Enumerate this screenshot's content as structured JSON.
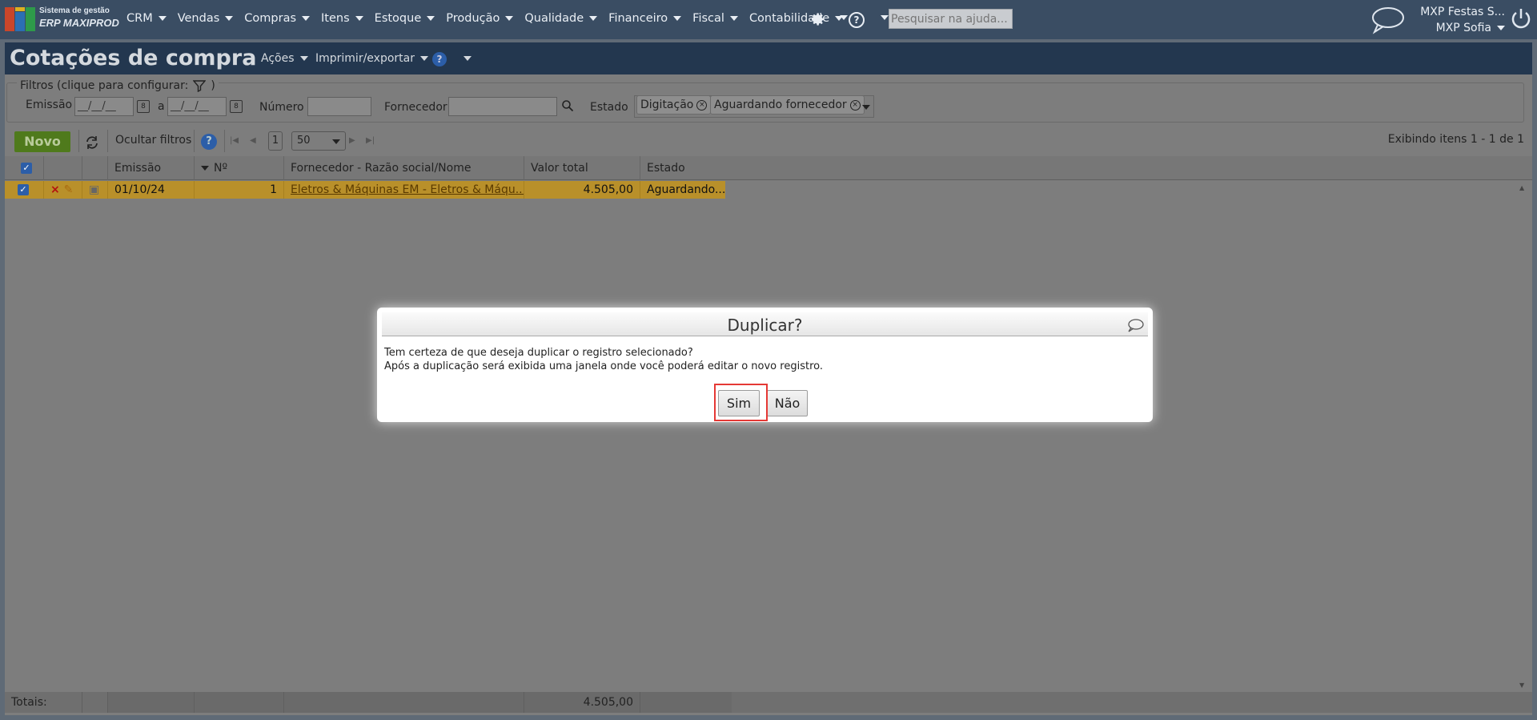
{
  "app": {
    "logo_line1": "Sistema de gestão",
    "logo_line2": "ERP MAXIPROD",
    "menu": [
      "CRM",
      "Vendas",
      "Compras",
      "Itens",
      "Estoque",
      "Produção",
      "Qualidade",
      "Financeiro",
      "Fiscal",
      "Contabilidade"
    ],
    "help_search_placeholder": "Pesquisar na ajuda...",
    "company": "MXP Festas S...",
    "user": "MXP Sofia",
    "icons": [
      "logo-icon",
      "gear-icon",
      "help-icon",
      "chat-icon",
      "power-icon"
    ]
  },
  "page": {
    "title": "Cotações de compra",
    "actions_label": "Ações",
    "print_export_label": "Imprimir/exportar",
    "help_label": "?"
  },
  "filters": {
    "legend": "Filtros (clique para configurar:",
    "legend_close": ")",
    "emissao_label": "Emissão",
    "date_from_placeholder": "__/__/__",
    "date_sep": "a",
    "date_to_placeholder": "__/__/__",
    "numero_label": "Número",
    "fornecedor_label": "Fornecedor",
    "estado_label": "Estado",
    "estado_tags": [
      "Digitação",
      "Aguardando fornecedor"
    ]
  },
  "toolbar": {
    "new_label": "Novo",
    "hide_filters_label": "Ocultar filtros",
    "current_page": "1",
    "page_size": "50",
    "status": "Exibindo itens 1 - 1 de 1"
  },
  "grid": {
    "columns": [
      "Emissão",
      "Nº",
      "Fornecedor - Razão social/Nome",
      "Valor total",
      "Estado"
    ],
    "rows": [
      {
        "emissao": "01/10/24",
        "numero": "1",
        "fornecedor": "Eletros & Máquinas EM - Eletros & Máqu...",
        "valor": "4.505,00",
        "estado": "Aguardando..."
      }
    ],
    "totals_label": "Totais:",
    "totals_value": "4.505,00"
  },
  "dialog": {
    "title": "Duplicar?",
    "line1": "Tem certeza de que deseja duplicar o registro selecionado?",
    "line2": "Após a duplicação será exibida uma janela onde você poderá editar o novo registro.",
    "yes_label": "Sim",
    "no_label": "Não"
  },
  "colors": {
    "nav_bg": "#3a4d63",
    "title_bg": "#23374f",
    "new_button": "#4f7a1c",
    "selected_row": "#b9902a",
    "highlight": "#e53935"
  }
}
